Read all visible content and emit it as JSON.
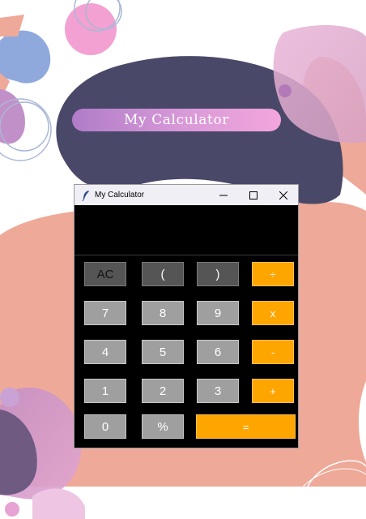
{
  "banner": {
    "title": "My Calculator"
  },
  "window": {
    "title": "My Calculator",
    "icons": {
      "app": "feather-icon",
      "minimize": "minimize-icon",
      "maximize": "maximize-icon",
      "close": "close-icon"
    },
    "display_value": ""
  },
  "buttons": {
    "row1": [
      "AC",
      "(",
      ")",
      "÷"
    ],
    "row2": [
      "7",
      "8",
      "9",
      "x"
    ],
    "row3": [
      "4",
      "5",
      "6",
      "-"
    ],
    "row4": [
      "1",
      "2",
      "3",
      "+"
    ],
    "row5": [
      "0",
      "%",
      "="
    ]
  },
  "colors": {
    "operator": "#ffa500",
    "digit": "#9f9f9f",
    "function": "#555555",
    "display_bg": "#000000",
    "navy_shape": "#4a4868",
    "salmon_shape": "#eea998"
  }
}
